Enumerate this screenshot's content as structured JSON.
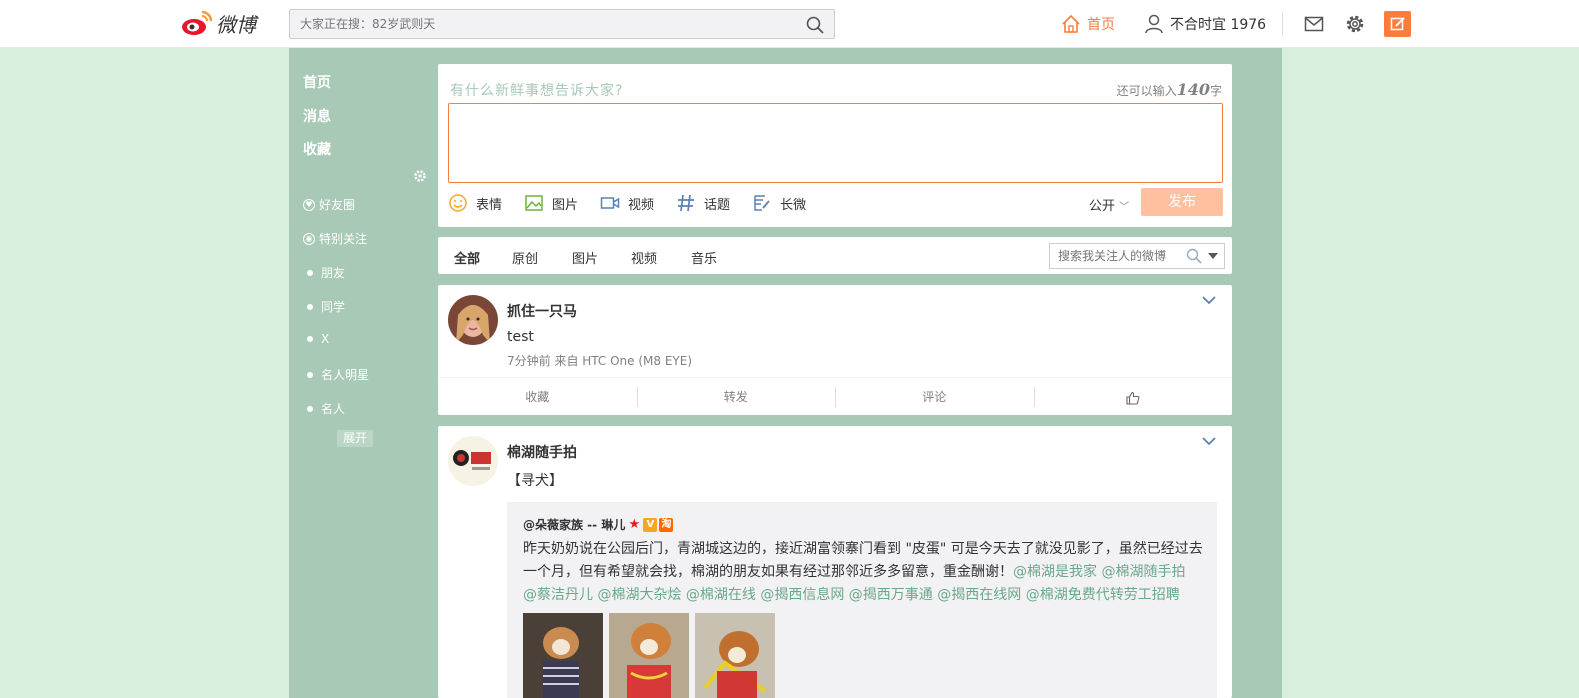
{
  "header": {
    "logo_text": "微博",
    "search_placeholder": "大家正在搜：82岁武则天",
    "nav_home": "首页",
    "nav_user": "不合时宜 1976"
  },
  "sidebar": {
    "main": [
      "首页",
      "消息",
      "收藏"
    ],
    "groups": [
      {
        "label": "好友圈",
        "icon": "ring-icon"
      },
      {
        "label": "特别关注",
        "icon": "ring-icon"
      },
      {
        "label": "朋友",
        "icon": "dot"
      },
      {
        "label": "同学",
        "icon": "dot"
      },
      {
        "label": "X",
        "icon": "dot"
      },
      {
        "label": "名人明星",
        "icon": "dot"
      },
      {
        "label": "名人",
        "icon": "dot"
      }
    ],
    "expand": "展开"
  },
  "compose": {
    "prompt": "有什么新鲜事想告诉大家?",
    "remain_prefix": "还可以输入",
    "remain_count": "140",
    "remain_suffix": "字",
    "tools": [
      "表情",
      "图片",
      "视频",
      "话题",
      "长微"
    ],
    "privacy": "公开",
    "publish": "发布"
  },
  "filter": {
    "tabs": [
      "全部",
      "原创",
      "图片",
      "视频",
      "音乐"
    ],
    "search_placeholder": "搜索我关注人的微博"
  },
  "posts": [
    {
      "author": "抓住一只马",
      "text": "test",
      "meta": "7分钟前 来自 HTC One (M8 EYE)",
      "actions": [
        "收藏",
        "转发",
        "评论"
      ]
    },
    {
      "author": "棉湖随手拍",
      "text": "【寻犬】",
      "quote_author": "@朵薇家族 -- 琳儿",
      "quote_text": "昨天奶奶说在公园后门，青湖城这边的，接近湖富领寨门看到 \"皮蛋\" 可是今天去了就没见影了，虽然已经过去一个月，但有希望就会找，棉湖的朋友如果有经过那邻近多多留意，重金酬谢！",
      "mentions": "@棉湖是我家 @棉湖随手拍 @蔡洁丹儿 @棉湖大杂烩 @棉湖在线 @揭西信息网 @揭西万事通 @揭西在线网 @棉湖免费代转劳工招聘"
    }
  ],
  "colors": {
    "accent": "#fa7d3c",
    "column_bg": "#a7c9b6",
    "page_bg": "#d8efdc",
    "mention": "#6aa88a"
  }
}
